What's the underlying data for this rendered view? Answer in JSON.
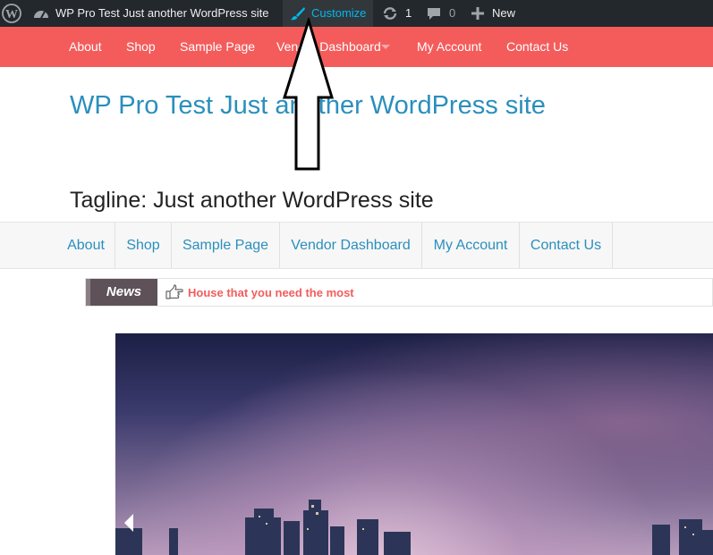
{
  "admin_bar": {
    "site_name": "WP Pro Test Just another WordPress site",
    "customize": "Customize",
    "updates_count": "1",
    "comments_count": "0",
    "new_label": "New"
  },
  "top_menu": {
    "items": [
      "About",
      "Shop",
      "Sample Page",
      "Vendor Dashboard",
      "My Account",
      "Contact Us"
    ]
  },
  "site": {
    "title": "WP Pro Test Just another WordPress site",
    "tagline": "Tagline: Just another WordPress site"
  },
  "main_nav": {
    "items": [
      "About",
      "Shop",
      "Sample Page",
      "Vendor Dashboard",
      "My Account",
      "Contact Us"
    ]
  },
  "ticker": {
    "label": "News",
    "headline": "House that you need the most"
  },
  "colors": {
    "admin_bar": "#23282d",
    "accent_red": "#f45c5c",
    "link_blue": "#2a8fbd",
    "customize_blue": "#00b9eb"
  },
  "icons": [
    "wordpress-icon",
    "dashboard-icon",
    "brush-icon",
    "updates-icon",
    "comment-icon",
    "plus-icon",
    "pointing-hand-icon",
    "chevron-left-icon"
  ]
}
